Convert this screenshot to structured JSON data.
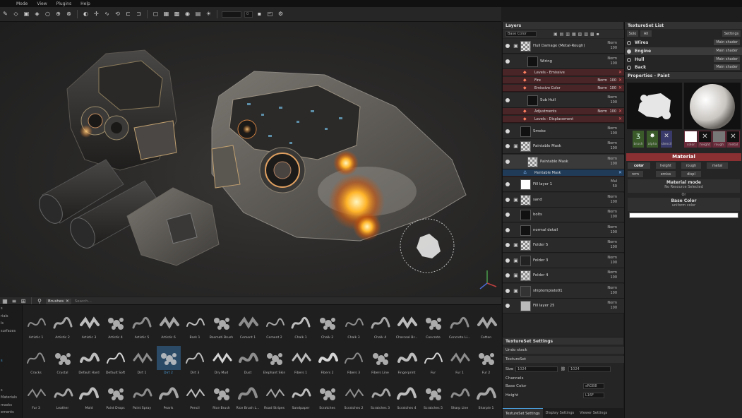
{
  "menu": [
    "",
    "Mode",
    "View",
    "Plugins",
    "Help"
  ],
  "toolbar": {
    "num1": "",
    "num2": "0"
  },
  "colors": {
    "accent": "#4a9fdc",
    "material_header": "#8a2f32",
    "filter_row": "#4a2527"
  },
  "shelf": {
    "filter_tag": "Brushes",
    "search_placeholder": "Search...",
    "categories": [
      "s",
      "rials",
      "ls",
      "surfaces",
      "",
      "",
      "",
      "s",
      "",
      "",
      "",
      "s",
      "Materials",
      "masks",
      "ements",
      "endings"
    ],
    "brushes": [
      [
        "Artistic 1",
        "Artistic 2",
        "Artistic 3",
        "Artistic 4",
        "Artistic 5",
        "Artistic 6",
        "Bark 1",
        "Basmati Brush",
        "Cement 1",
        "Cement 2",
        "Chalk 1",
        "Chalk 2",
        "Chalk 3",
        "Chalk 4",
        "Charcoal Br...",
        "Concrete",
        "Concrete Li...",
        "Cotton"
      ],
      [
        "Cracks",
        "Crystal",
        "Default Hard",
        "Default Soft",
        "Dirt 1",
        "Dirt 2",
        "Dirt 3",
        "Dry Mud",
        "Dust",
        "Elephant Skin",
        "Fibers 1",
        "Fibers 2",
        "Fibers 3",
        "Fibers Line",
        "Fingerprint",
        "Fur",
        "Fur 1",
        "Fur 2"
      ],
      [
        "Fur 3",
        "Leather",
        "Mold",
        "Paint Drops",
        "Paint Spray",
        "Pearls",
        "Pencil",
        "Rice Brush",
        "Rice Brush L...",
        "Road Stripes",
        "Sandpaper",
        "Scratches",
        "Scratches 2",
        "Scratches 3",
        "Scratches 4",
        "Scratches 5",
        "Sharp Line",
        "Sharpie 1"
      ]
    ]
  },
  "layers": {
    "title": "Layers",
    "channel": "Base Color",
    "rows": [
      {
        "name": "Hull Damage (Metal-Rough)",
        "blend": "Norm",
        "opacity": "100"
      },
      {
        "name": "Wiring",
        "blend": "Norm",
        "opacity": "100"
      },
      {
        "name": "Sub Hull",
        "blend": "Norm",
        "opacity": "100"
      },
      {
        "name": "Smoke",
        "blend": "Norm",
        "opacity": "100"
      },
      {
        "name": "Paintable Mask",
        "blend": "Norm",
        "opacity": "100"
      },
      {
        "name": "Paintable Mask",
        "blend": "Norm",
        "opacity": "100"
      },
      {
        "name": "Fill layer 1",
        "blend": "Mul",
        "opacity": "50"
      },
      {
        "name": "sand",
        "blend": "Norm",
        "opacity": "100"
      },
      {
        "name": "bolts",
        "blend": "Norm",
        "opacity": "100"
      },
      {
        "name": "normal detail",
        "blend": "Norm",
        "opacity": "100"
      },
      {
        "name": "Folder 5",
        "blend": "Norm",
        "opacity": "100"
      },
      {
        "name": "Folder 3",
        "blend": "Norm",
        "opacity": "100"
      },
      {
        "name": "Folder 4",
        "blend": "Norm",
        "opacity": "100"
      },
      {
        "name": "shiptemplate01",
        "blend": "Norm",
        "opacity": "100"
      },
      {
        "name": "Fill layer 25",
        "blend": "Norm",
        "opacity": "100"
      }
    ],
    "filters_a": [
      {
        "name": "Levels - Emissive",
        "blend": "",
        "value": ""
      },
      {
        "name": "Fire",
        "blend": "Norm",
        "value": "100"
      },
      {
        "name": "Emissive Color",
        "blend": "Norm",
        "value": "100"
      }
    ],
    "filters_b": [
      {
        "name": "Adjustments",
        "blend": "Norm",
        "value": "100"
      },
      {
        "name": "Levels - Displacement",
        "blend": "",
        "value": ""
      }
    ],
    "mask_label": "Paintable Mask"
  },
  "tss": {
    "title": "TextureSet Settings",
    "undo": "Undo stack",
    "textureset": "TextureSet",
    "size_label": "Size",
    "size_value": "1024",
    "size_value2": "1024",
    "channels": "Channels",
    "ch1": "Base Color",
    "ch1_fmt": "sRGB8",
    "ch2": "Height",
    "ch2_fmt": "L16F",
    "tabs": [
      "TextureSet Settings",
      "Display Settings",
      "Viewer Settings"
    ]
  },
  "tsl": {
    "title": "TextureSet List",
    "solo": "Solo",
    "all": "All",
    "settings": "Settings",
    "items": [
      {
        "name": "Wires",
        "shader": "Main shader"
      },
      {
        "name": "Engine",
        "shader": "Main shader"
      },
      {
        "name": "Hull",
        "shader": "Main shader"
      },
      {
        "name": "Back",
        "shader": "Main shader"
      }
    ]
  },
  "props": {
    "title": "Properties - Paint",
    "swatches": [
      "brush",
      "alpha",
      "stencil"
    ],
    "channels": [
      "color",
      "height",
      "rough",
      "metal"
    ],
    "material": "Material",
    "mbtns": [
      "color",
      "height",
      "rough",
      "metal",
      "nrm",
      "emiss",
      "displ"
    ],
    "mode": "Material mode",
    "no_res": "No Resource Selected",
    "or": "Or",
    "base_color": "Base Color",
    "uniform": "uniform color"
  }
}
